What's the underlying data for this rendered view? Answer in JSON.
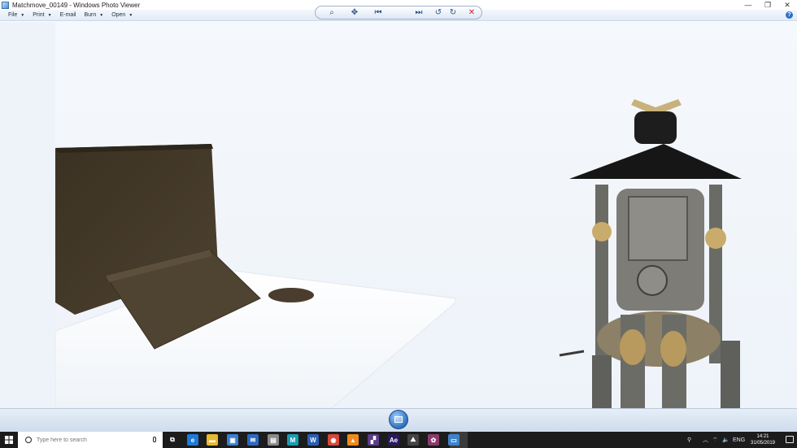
{
  "window": {
    "title": "Matchmove_00149 - Windows Photo Viewer",
    "controls": {
      "minimize": "—",
      "maximize": "❐",
      "close": "✕"
    }
  },
  "menu": {
    "items": [
      {
        "label": "File",
        "has_caret": true
      },
      {
        "label": "Print",
        "has_caret": true
      },
      {
        "label": "E-mail",
        "has_caret": false
      },
      {
        "label": "Burn",
        "has_caret": true
      },
      {
        "label": "Open",
        "has_caret": true
      }
    ],
    "help_glyph": "?"
  },
  "viewer_controls": {
    "zoom_glyph": "⌕",
    "fit_glyph": "✥",
    "prev_glyph": "⏮",
    "next_glyph": "⏭",
    "rotate_ccw_glyph": "↺",
    "rotate_cw_glyph": "↻",
    "delete_glyph": "✕",
    "delete_color": "#c0272d"
  },
  "taskbar": {
    "search_placeholder": "Type here to search",
    "apps": [
      {
        "name": "task-view",
        "glyph": "⧉",
        "color": "#1c1c1c"
      },
      {
        "name": "edge",
        "glyph": "e",
        "color": "#1f7ad9"
      },
      {
        "name": "file-explorer",
        "glyph": "▬",
        "color": "#e8b933"
      },
      {
        "name": "store",
        "glyph": "▣",
        "color": "#3b7fd1"
      },
      {
        "name": "mail",
        "glyph": "✉",
        "color": "#2c68c0"
      },
      {
        "name": "app-6",
        "glyph": "▤",
        "color": "#8a8a8a"
      },
      {
        "name": "app-7",
        "glyph": "M",
        "color": "#1a9bb3"
      },
      {
        "name": "word",
        "glyph": "W",
        "color": "#2b5fb4"
      },
      {
        "name": "chrome",
        "glyph": "◉",
        "color": "#d9463b"
      },
      {
        "name": "vlc",
        "glyph": "▲",
        "color": "#f08a1c"
      },
      {
        "name": "app-11",
        "glyph": "▞",
        "color": "#5c3b8a"
      },
      {
        "name": "after-effects",
        "glyph": "Ae",
        "color": "#2a1a5c"
      },
      {
        "name": "photos",
        "glyph": "⛰",
        "color": "#444444"
      },
      {
        "name": "app-14",
        "glyph": "✿",
        "color": "#8b3a6e"
      },
      {
        "name": "photo-viewer",
        "glyph": "▭",
        "color": "#3f82c9"
      }
    ],
    "tray": {
      "people_glyph": "⚲",
      "chevron": "︿",
      "network_glyph": "⌔",
      "volume_glyph": "🔈",
      "language": "ENG"
    },
    "time": "14:21",
    "date": "31/05/2019"
  }
}
